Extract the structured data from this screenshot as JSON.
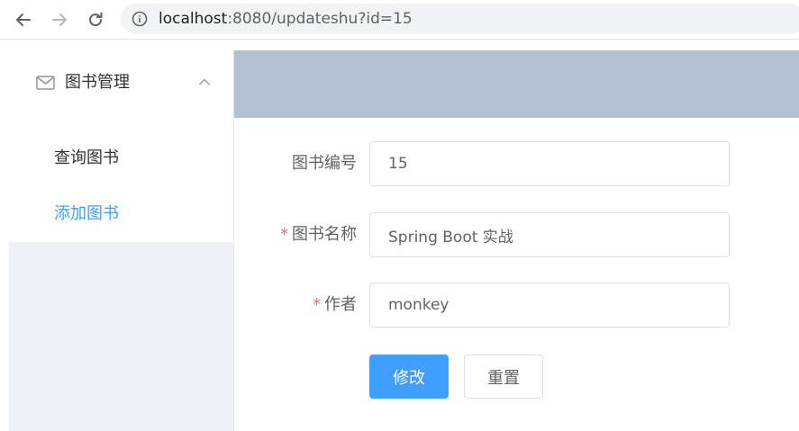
{
  "browser": {
    "url_host": "localhost",
    "url_rest": ":8080/updateshu?id=15"
  },
  "sidebar": {
    "submenu_title": "图书管理",
    "items": [
      {
        "label": "查询图书",
        "active": false
      },
      {
        "label": "添加图书",
        "active": true
      }
    ]
  },
  "form": {
    "fields": [
      {
        "label": "图书编号",
        "value": "15",
        "required": false
      },
      {
        "label": "图书名称",
        "value": "Spring Boot 实战",
        "required": true
      },
      {
        "label": "作者",
        "value": "monkey",
        "required": true
      }
    ],
    "required_mark": "*",
    "submit_label": "修改",
    "reset_label": "重置"
  },
  "colors": {
    "primary": "#409eff",
    "header_bg": "#b3c0d1",
    "sidebar_bg": "#eef1f6",
    "required": "#f56c6c"
  }
}
